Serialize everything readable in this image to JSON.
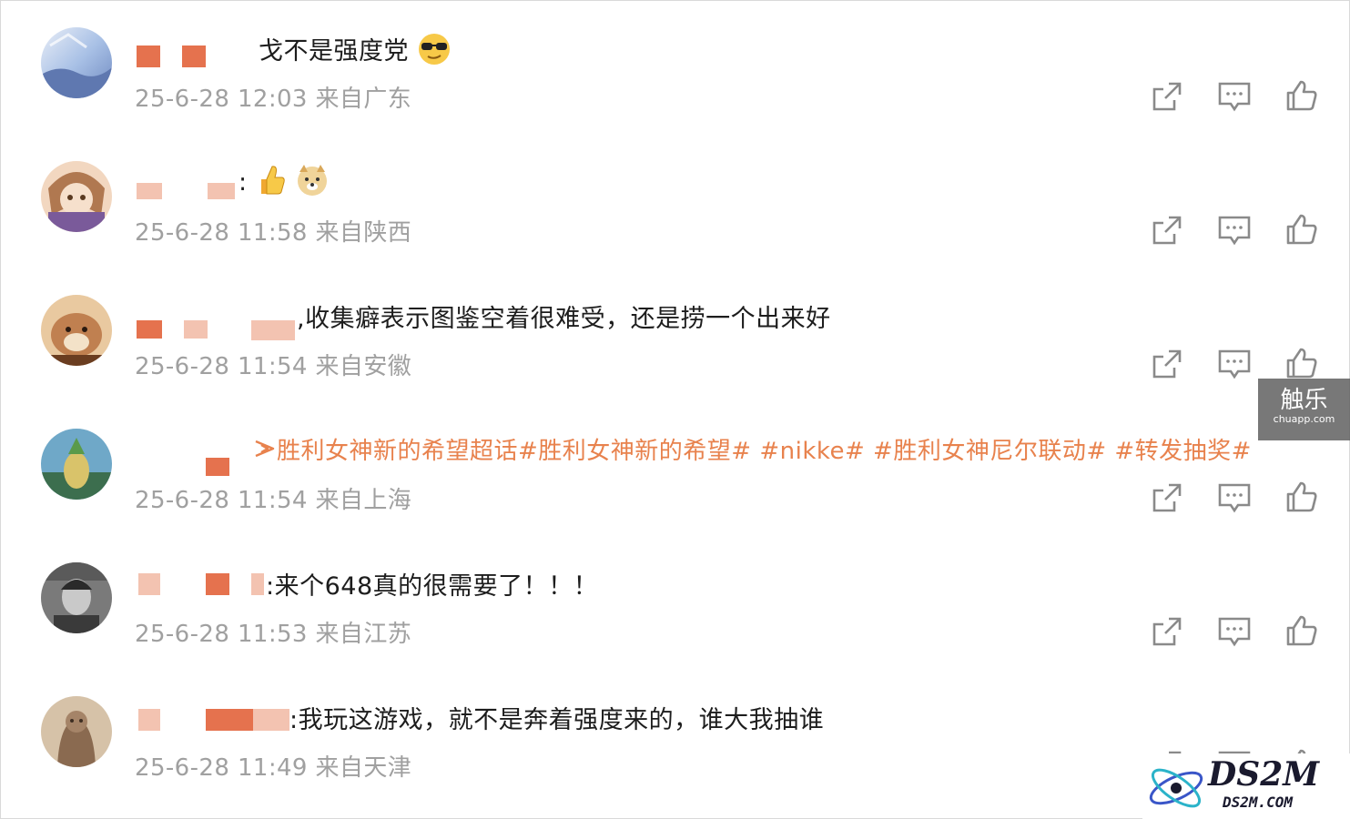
{
  "comments": [
    {
      "text": "戈不是强度党",
      "meta": "25-6-28 12:03 来自广东",
      "emoji": "cool-sunglasses-emoji",
      "avatar_colors": [
        "#a9c1e6",
        "#6d88c0",
        "#e9eef7"
      ]
    },
    {
      "text": ":",
      "meta": "25-6-28 11:58 来自陕西",
      "emoji": "thumbs-up-emoji, doge-emoji",
      "avatar_colors": [
        "#d8a37a",
        "#7a5a9a",
        "#f2d7c0"
      ]
    },
    {
      "text": ",收集癖表示图鉴空着很难受，还是捞一个出来好",
      "meta": "25-6-28 11:54 来自安徽",
      "avatar_colors": [
        "#c08050",
        "#6a3d20",
        "#e9c9a0"
      ]
    },
    {
      "text": "胜利女神新的希望超话#胜利女神新的希望# #nikke# #胜利女神尼尔联动# #转发抽奖#",
      "meta": "25-6-28 11:54 来自上海",
      "avatar_colors": [
        "#6fa8c8",
        "#d9c36a",
        "#3c6e4e"
      ]
    },
    {
      "text": ":来个648真的很需要了！！！",
      "meta": "25-6-28 11:53 来自江苏",
      "avatar_colors": [
        "#3a3a3a",
        "#c9c9c9",
        "#7a7a7a"
      ]
    },
    {
      "text": ":我玩这游戏，就不是奔着强度来的，谁大我抽谁",
      "meta": "25-6-28 11:49 来自天津",
      "avatar_colors": [
        "#8a6a50",
        "#d6c2a8",
        "#3e2e22"
      ]
    }
  ],
  "icons": {
    "share": "share-icon",
    "comment": "comment-icon",
    "like": "thumbs-up-icon",
    "topic": "topic-icon"
  },
  "watermarks": {
    "chule_main": "触乐",
    "chule_sub": "chuapp.com",
    "ds2m_main": "DS2M",
    "ds2m_sub": "DS2M.COM"
  },
  "colors": {
    "redaction": "#e5724e",
    "redaction_faint": "#f3c3b1",
    "topic_orange": "#e8824d",
    "meta_gray": "#a0a0a0",
    "icon_gray": "#8a8a8a"
  }
}
